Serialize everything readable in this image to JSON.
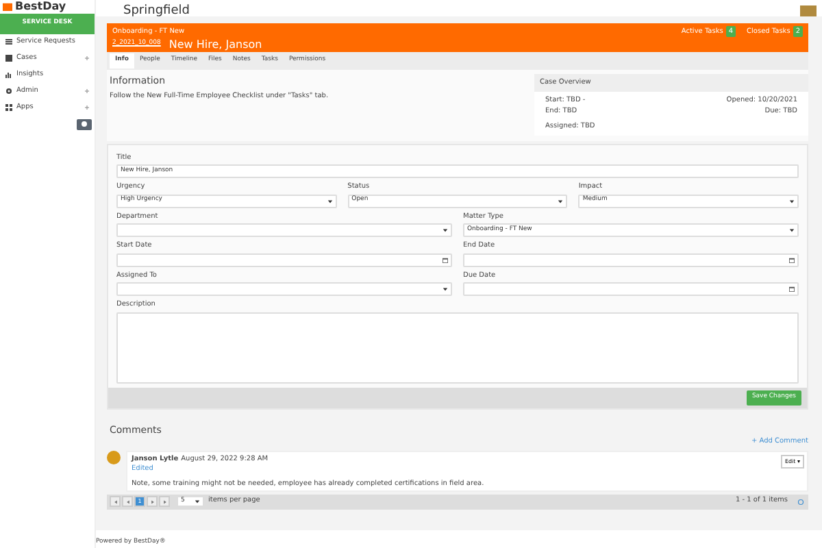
{
  "brand": {
    "logo_text": "BestDay",
    "location": "Springfield"
  },
  "sidebar": {
    "header": "SERVICE DESK",
    "items": [
      {
        "label": "Service Requests",
        "expandable": false
      },
      {
        "label": "Cases",
        "expandable": true
      },
      {
        "label": "Insights",
        "expandable": false
      },
      {
        "label": "Admin",
        "expandable": true
      },
      {
        "label": "Apps",
        "expandable": true
      }
    ]
  },
  "case": {
    "type": "Onboarding - FT New",
    "number": "2_2021_10_008",
    "title": "New Hire, Janson",
    "counters": [
      {
        "label": "Active Tasks",
        "value": "4"
      },
      {
        "label": "Closed Tasks",
        "value": "2"
      }
    ]
  },
  "tabs": [
    {
      "label": "Info",
      "selected": true
    },
    {
      "label": "People",
      "selected": false
    },
    {
      "label": "Timeline",
      "selected": false
    },
    {
      "label": "Files",
      "selected": false
    },
    {
      "label": "Notes",
      "selected": false
    },
    {
      "label": "Tasks",
      "selected": false
    },
    {
      "label": "Permissions",
      "selected": false
    }
  ],
  "information": {
    "heading": "Information",
    "text": "Follow the New Full-Time Employee Checklist under \"Tasks\" tab."
  },
  "overview": {
    "heading": "Case Overview",
    "start": "Start: TBD -",
    "end": "End: TBD",
    "opened": "Opened: 10/20/2021",
    "due": "Due: TBD",
    "assigned": "Assigned: TBD"
  },
  "form": {
    "fields": [
      {
        "label": "Title",
        "kind": "text",
        "value": "New Hire, Janson"
      },
      {
        "label": "Urgency",
        "kind": "select",
        "value": "High Urgency"
      },
      {
        "label": "Status",
        "kind": "select",
        "value": "Open"
      },
      {
        "label": "Impact",
        "kind": "select",
        "value": "Medium"
      },
      {
        "label": "Department",
        "kind": "select"
      },
      {
        "label": "Matter Type",
        "kind": "select",
        "value": "Onboarding - FT New"
      },
      {
        "label": "Start Date",
        "kind": "date"
      },
      {
        "label": "End Date",
        "kind": "date"
      },
      {
        "label": "Assigned To",
        "kind": "select"
      },
      {
        "label": "Due Date",
        "kind": "date"
      },
      {
        "label": "Description",
        "kind": "textarea"
      }
    ],
    "save_button": "Save Changes"
  },
  "comments": {
    "heading": "Comments",
    "add": "+ Add Comment",
    "items": [
      {
        "author": "Janson Lytle",
        "date": "August 29, 2022 9:28 AM",
        "edited": "Edited",
        "text": "Note, some training might not be needed, employee has already completed certifications in field area.",
        "edit": "Edit ▾"
      }
    ],
    "pager": {
      "pages": [
        {
          "label": "1",
          "selected": true
        }
      ],
      "page_size": "5",
      "per_page": "items per page",
      "summary": "1 - 1 of 1 items"
    }
  },
  "footer": "Powered by BestDay®"
}
